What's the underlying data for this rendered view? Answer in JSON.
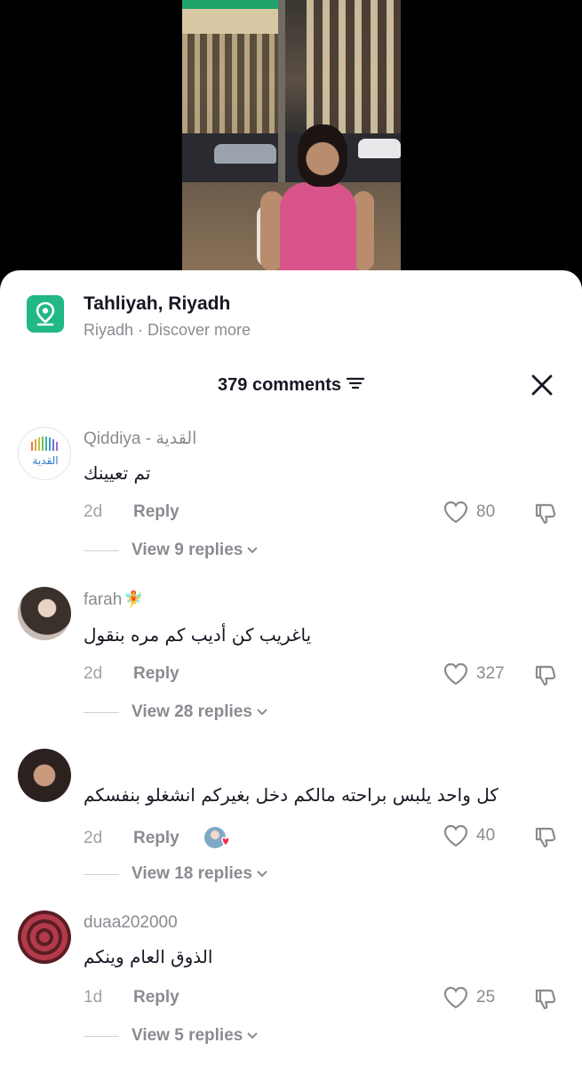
{
  "location": {
    "title": "Tahliyah, Riyadh",
    "subtitle": "Riyadh · Discover more"
  },
  "comments_header": {
    "count_label": "379 comments"
  },
  "icons": {
    "location": "location-pin-icon",
    "filter": "filter-icon",
    "close": "close-icon",
    "like": "heart-icon",
    "dislike": "thumbs-down-icon",
    "chevron": "chevron-down-icon"
  },
  "colors": {
    "accent_green": "#21b886",
    "text_primary": "#161823",
    "text_secondary": "#8a8b91"
  },
  "comments": [
    {
      "username": "Qiddiya - القدية",
      "text": "تم تعيينك",
      "time": "2d",
      "reply_label": "Reply",
      "likes": "80",
      "view_replies": "View 9 replies",
      "avatar_text": "القدية"
    },
    {
      "username": "farah",
      "username_emoji": "🧚",
      "text": "ياغريب كن أديب كم مره بنقول",
      "time": "2d",
      "reply_label": "Reply",
      "likes": "327",
      "view_replies": "View 28 replies"
    },
    {
      "username": "",
      "text": "كل واحد يلبس براحته مالكم دخل بغيركم انشغلو بنفسكم",
      "time": "2d",
      "reply_label": "Reply",
      "likes": "40",
      "view_replies": "View 18 replies"
    },
    {
      "username": "duaa202000",
      "text": "الذوق العام وينكم",
      "time": "1d",
      "reply_label": "Reply",
      "likes": "25",
      "view_replies": "View 5 replies"
    }
  ]
}
